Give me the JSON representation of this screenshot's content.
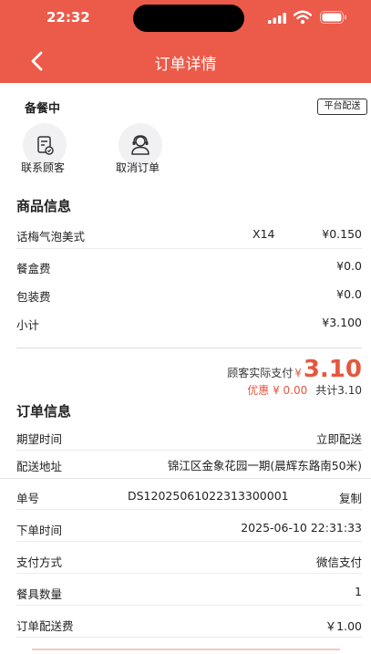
{
  "status_bar": {
    "time": "22:32"
  },
  "header": {
    "title": "订单详情",
    "back_icon": "chevron-left-icon",
    "color": "#ec5a4a"
  },
  "order_status": {
    "text": "备餐中",
    "badge": "平台配送"
  },
  "actions": [
    {
      "label": "联系顾客",
      "icon": "contact-customer-icon"
    },
    {
      "label": "取消订单",
      "icon": "cancel-order-icon"
    }
  ],
  "goods": {
    "title": "商品信息",
    "item": {
      "name": "话梅气泡美式",
      "qty": "X14",
      "price": "¥0.150"
    },
    "fees": [
      {
        "label": "餐盒费",
        "value": "¥0.0"
      },
      {
        "label": "包装费",
        "value": "¥0.0"
      },
      {
        "label": "小计",
        "value": "¥3.100"
      }
    ]
  },
  "payment": {
    "label": "顾客实际支付",
    "currency": "¥",
    "amount": "3.10",
    "discount": "优惠 ¥ 0.00",
    "total": "共计3.10",
    "accent": "#e5573f"
  },
  "order_info": {
    "title": "订单信息",
    "expected_time": {
      "label": "期望时间",
      "value": "立即配送"
    },
    "address": {
      "label": "配送地址",
      "value": "锦江区金象花园一期(晨辉东路南50米)"
    },
    "number": {
      "label": "单号",
      "value": "DS12025061022313300001",
      "copy": "复制"
    },
    "order_time": {
      "label": "下单时间",
      "value": "2025-06-10 22:31:33"
    },
    "pay_method": {
      "label": "支付方式",
      "value": "微信支付"
    },
    "utensils": {
      "label": "餐具数量",
      "value": "1"
    },
    "delivery_fee": {
      "label": "订单配送费",
      "value": "￥1.00"
    }
  }
}
